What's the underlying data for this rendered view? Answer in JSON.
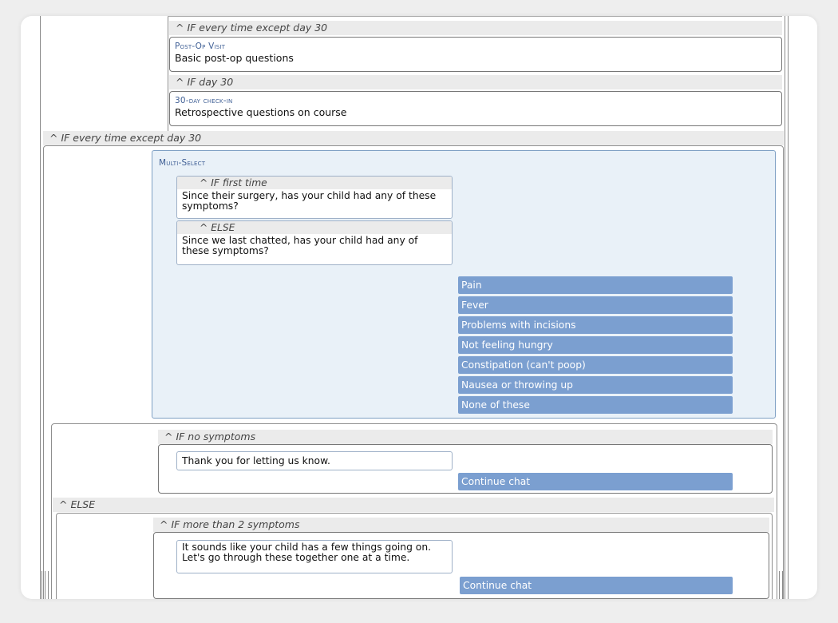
{
  "flow": {
    "visits": [
      {
        "condition": "^ IF every time except day 30",
        "title": "Post-Op Visit",
        "description": "Basic post-op questions"
      },
      {
        "condition": "^ IF day 30",
        "title": "30-day check-in",
        "description": "Retrospective questions on course"
      }
    ],
    "multi_select_condition": "^ IF every time except day 30",
    "multi_select": {
      "title": "Multi-Select",
      "questions": [
        {
          "condition": "^ IF first time",
          "text": "Since their surgery, has your child had any of these symptoms?"
        },
        {
          "condition": "^ ELSE",
          "text": "Since we last chatted, has your child had any of these symptoms?"
        }
      ],
      "options": [
        "Pain",
        "Fever",
        "Problems with incisions",
        "Not feeling hungry",
        "Constipation (can't poop)",
        "Nausea or throwing up",
        "None of these"
      ]
    },
    "no_symptoms": {
      "condition": "^ IF no symptoms",
      "message": "Thank you for letting us know.",
      "button": "Continue chat"
    },
    "else_label": "^ ELSE",
    "more_than_2": {
      "condition": "^ IF more than 2 symptoms",
      "message": "It sounds like your child has a few things going on. Let's go through these together one at a time.",
      "button": "Continue chat"
    }
  }
}
